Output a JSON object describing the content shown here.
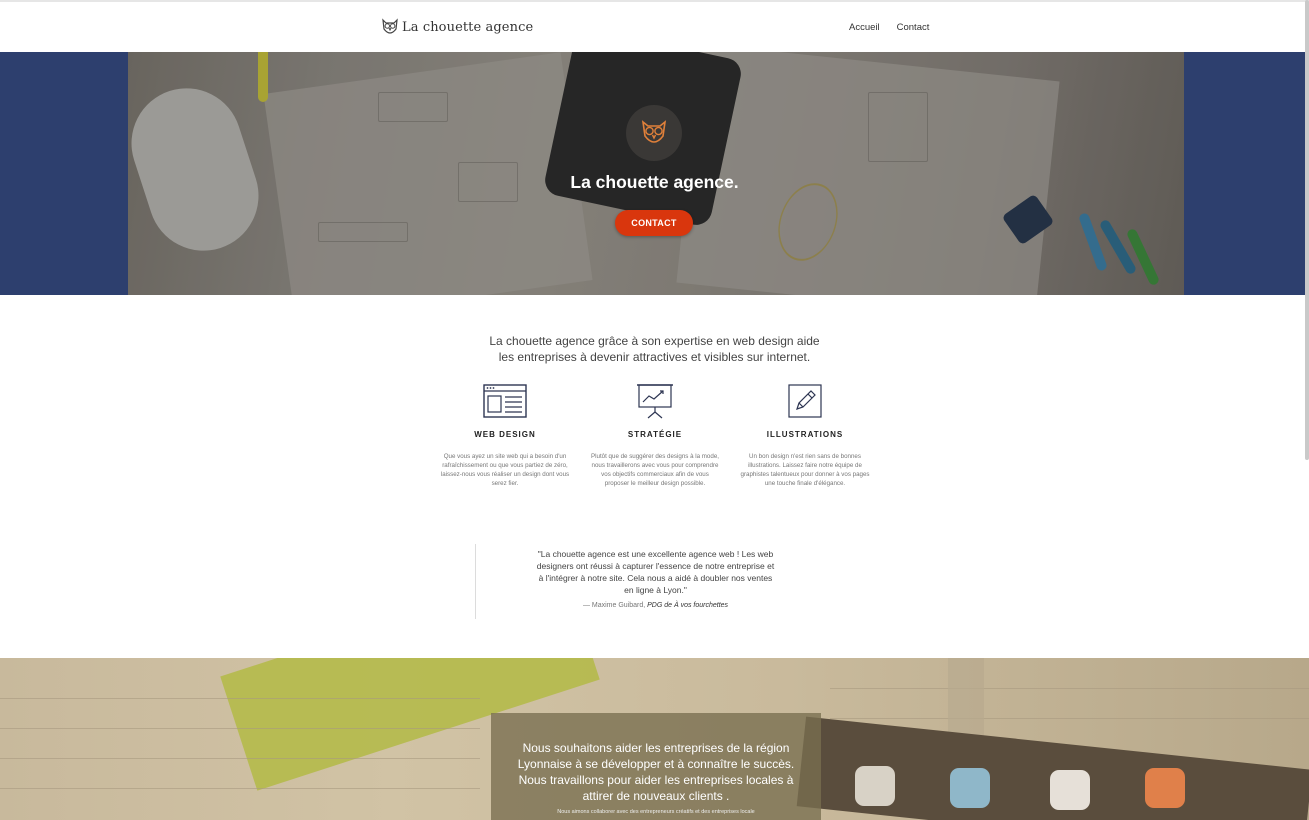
{
  "nav": {
    "brand": "La chouette agence",
    "links": [
      "Accueil",
      "Contact"
    ]
  },
  "hero": {
    "title": "La chouette agence.",
    "cta": "CONTACT"
  },
  "intro": {
    "line1": "La chouette agence grâce à son expertise en web design aide",
    "line2": "les entreprises à devenir attractives et visibles sur internet."
  },
  "features": [
    {
      "icon": "browser-window-icon",
      "title": "WEB DESIGN",
      "text": "Que vous ayez un site web qui a besoin d'un rafraîchissement ou que vous partiez de zéro, laissez-nous vous réaliser un design dont vous serez fier."
    },
    {
      "icon": "presentation-chart-icon",
      "title": "STRATÉGIE",
      "text": "Plutôt que de suggérer des designs à la mode, nous travaillerons avec vous pour comprendre vos objectifs commerciaux afin de vous proposer le meilleur design possible."
    },
    {
      "icon": "pencil-icon",
      "title": "ILLUSTRATIONS",
      "text": "Un bon design n'est rien sans de bonnes illustrations. Laissez faire notre équipe de graphistes talentueux pour donner à vos pages une touche finale d'élégance."
    }
  ],
  "testimonial": {
    "quote": "\"La chouette agence est une excellente agence web ! Les web designers ont réussi à capturer l'essence de notre entreprise et à l'intégrer à notre site. Cela nous a aidé à doubler nos ventes en ligne à Lyon.\"",
    "author": "— Maxime Guibard, ",
    "role": "PDG de À vos fourchettes"
  },
  "mission": {
    "lead": "Nous souhaitons aider les entreprises de la région Lyonnaise à se développer et à connaître le succès. Nous travaillons pour aider les entreprises locales à attirer de nouveaux clients .",
    "small": "Nous aimons collaborer avec des entrepreneurs créatifs et des entreprises locale"
  },
  "colors": {
    "hero_band": "#2d3f6e",
    "cta": "#d9360d",
    "icon_stroke": "#2d3552"
  }
}
